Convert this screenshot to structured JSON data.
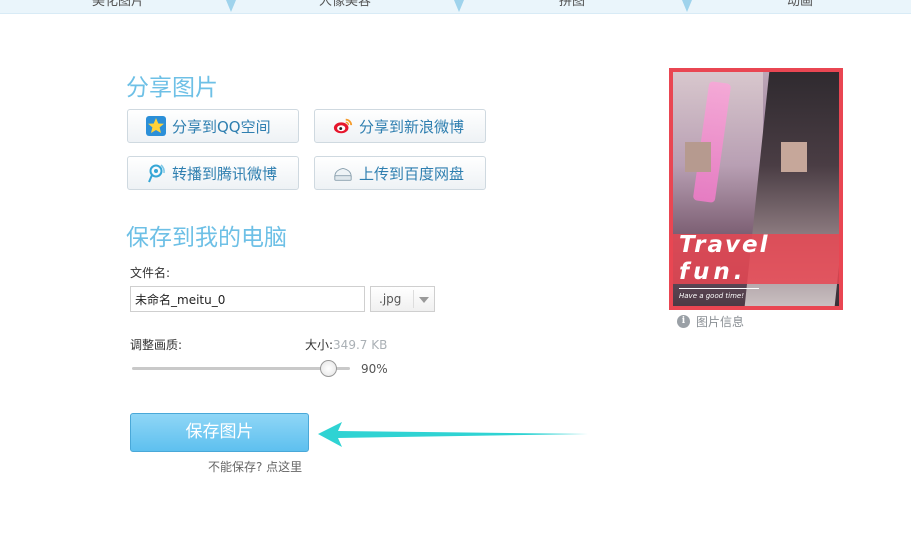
{
  "top_tabs": [
    {
      "label": "美化图片"
    },
    {
      "label": "人像美容"
    },
    {
      "label": "拼图"
    },
    {
      "label": "动画"
    }
  ],
  "share": {
    "title": "分享图片",
    "buttons": [
      {
        "label": "分享到QQ空间",
        "icon": "qzone-star-icon"
      },
      {
        "label": "分享到新浪微博",
        "icon": "weibo-icon"
      },
      {
        "label": "转播到腾讯微博",
        "icon": "tencent-weibo-icon"
      },
      {
        "label": "上传到百度网盘",
        "icon": "baidu-pan-icon"
      }
    ]
  },
  "save": {
    "title": "保存到我的电脑",
    "filename_label": "文件名:",
    "filename_value": "未命名_meitu_0",
    "extension": ".jpg",
    "quality_label": "调整画质:",
    "size_label": "大小:",
    "size_value": "349.7 KB",
    "quality_percent": 90,
    "quality_display": "90%",
    "save_button": "保存图片",
    "help_link": "不能保存? 点这里"
  },
  "preview": {
    "overlay_line1": "Travel",
    "overlay_line2": "fun.",
    "overlay_small": "Have a good time!",
    "info_label": "图片信息"
  },
  "colors": {
    "accent": "#6ec0e6",
    "save_button": "#5ec0ef",
    "arrow": "#2fd3d3",
    "preview_frame": "#e94652"
  }
}
